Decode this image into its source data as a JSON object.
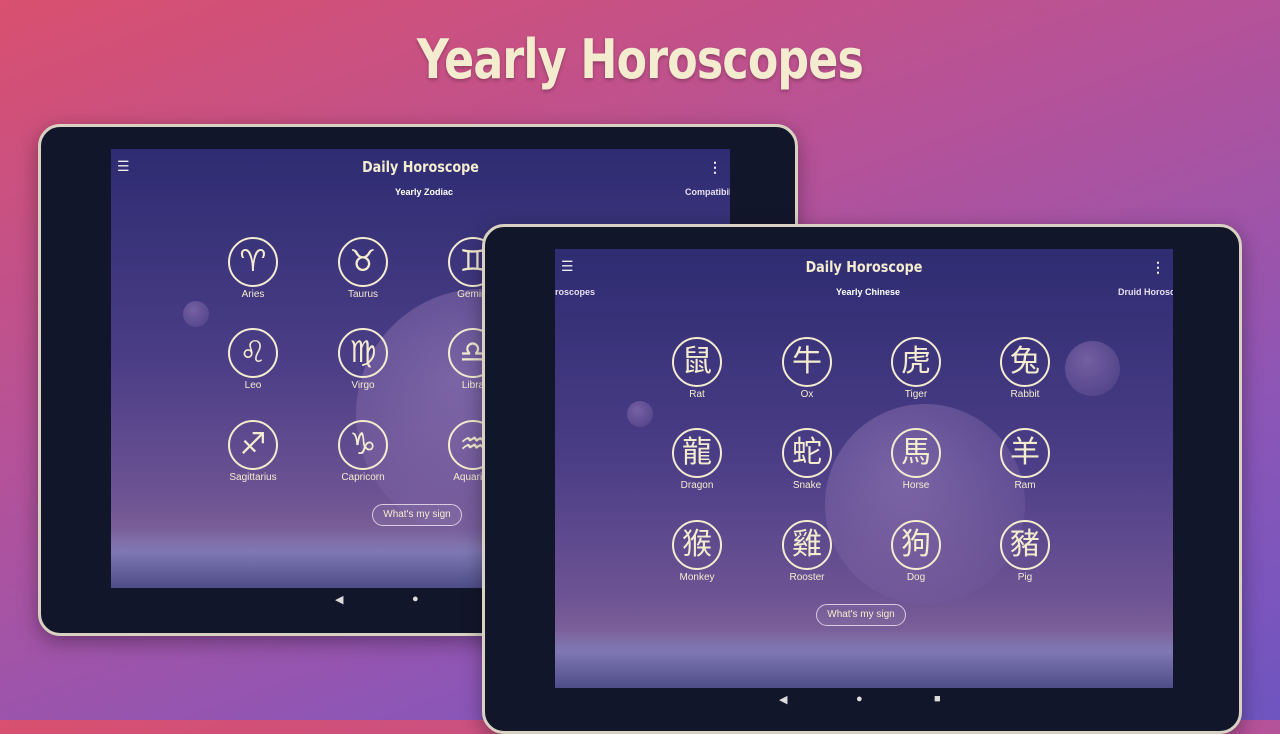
{
  "headline": "Yearly Horoscopes",
  "left": {
    "title": "Daily Horoscope",
    "tabs": [
      "Yearly Zodiac",
      "Compatibility"
    ],
    "signs": [
      {
        "name": "Aries",
        "glyph": "♈"
      },
      {
        "name": "Taurus",
        "glyph": "♉"
      },
      {
        "name": "Gemini",
        "glyph": "♊"
      },
      {
        "name": "Leo",
        "glyph": "♌"
      },
      {
        "name": "Virgo",
        "glyph": "♍"
      },
      {
        "name": "Libra",
        "glyph": "♎"
      },
      {
        "name": "Sagittarius",
        "glyph": "♐"
      },
      {
        "name": "Capricorn",
        "glyph": "♑"
      },
      {
        "name": "Aquarius",
        "glyph": "♒"
      }
    ],
    "button": "What's my sign"
  },
  "right": {
    "title": "Daily Horoscope",
    "tabs": [
      "Horoscopes",
      "Yearly Chinese",
      "Druid Horoscope"
    ],
    "signs": [
      {
        "name": "Rat",
        "glyph": "鼠"
      },
      {
        "name": "Ox",
        "glyph": "牛"
      },
      {
        "name": "Tiger",
        "glyph": "虎"
      },
      {
        "name": "Rabbit",
        "glyph": "兔"
      },
      {
        "name": "Dragon",
        "glyph": "龍"
      },
      {
        "name": "Snake",
        "glyph": "蛇"
      },
      {
        "name": "Horse",
        "glyph": "馬"
      },
      {
        "name": "Ram",
        "glyph": "羊"
      },
      {
        "name": "Monkey",
        "glyph": "猴"
      },
      {
        "name": "Rooster",
        "glyph": "雞"
      },
      {
        "name": "Dog",
        "glyph": "狗"
      },
      {
        "name": "Pig",
        "glyph": "豬"
      }
    ],
    "button": "What's my sign"
  },
  "nav": {
    "back": "◀",
    "home": "●",
    "recents": "■"
  }
}
